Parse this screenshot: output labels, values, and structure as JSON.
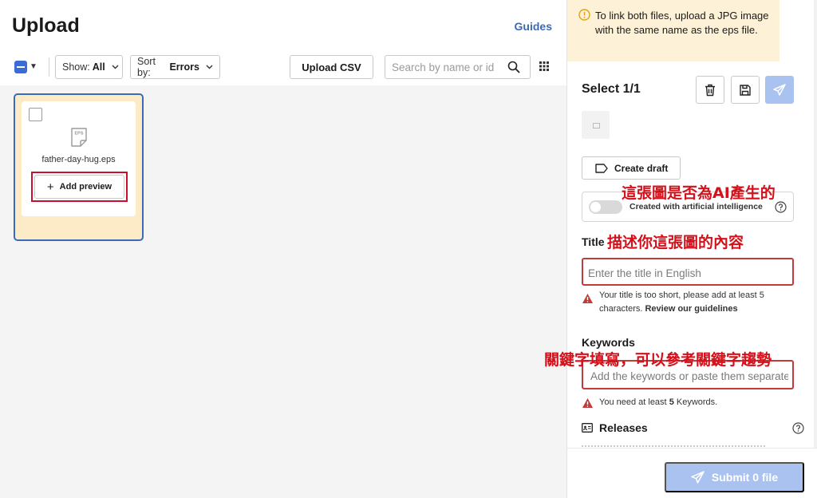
{
  "header": {
    "title": "Upload",
    "guides_label": "Guides"
  },
  "toolbar": {
    "show_prefix": "Show:",
    "show_value": "All",
    "sort_prefix": "Sort by:",
    "sort_value": "Errors",
    "upload_csv_label": "Upload CSV",
    "search_placeholder": "Search by name or id"
  },
  "files": [
    {
      "name": "father-day-hug.eps",
      "type_badge": "EPS",
      "add_preview_label": "Add preview",
      "selected": true
    }
  ],
  "notice": {
    "text": "To link both files, upload a JPG image with the same name as the eps file."
  },
  "panel": {
    "select_title": "Select 1/1",
    "create_draft_label": "Create draft",
    "ai_toggle_label": "Created with artificial intelligence",
    "title_label": "Title",
    "title_placeholder": "Enter the title in English",
    "title_error_text": "Your title is too short, please add at least 5 characters.",
    "title_error_link": "Review our guidelines",
    "keywords_label": "Keywords",
    "keywords_placeholder": "Add the keywords or paste them separated",
    "keywords_error_prefix": "You need at least",
    "keywords_error_count": "5",
    "keywords_error_suffix": "Keywords.",
    "releases_label": "Releases",
    "submit_label": "Submit 0 file"
  },
  "annotations": {
    "ai": "這張圖是否為AI產生的",
    "title": "描述你這張圖的內容",
    "keywords": "關鍵字填寫，可以參考關鍵字趨勢"
  },
  "colors": {
    "accent": "#3b6bb5",
    "error": "#c23a3a",
    "annotation": "#d4101a",
    "card_bg": "#fdebc8",
    "notice_bg": "#fdf1d8",
    "disabled_primary": "#a9c2ef"
  }
}
